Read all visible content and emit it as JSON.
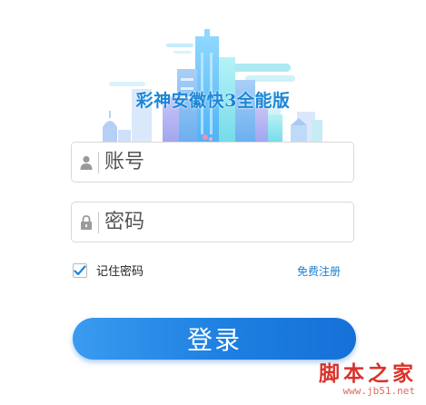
{
  "app": {
    "title": "彩神安徽快3全能版"
  },
  "login_form": {
    "account": {
      "placeholder": "账号",
      "value": "",
      "icon": "user-icon"
    },
    "password": {
      "placeholder": "密码",
      "value": "",
      "icon": "lock-icon"
    },
    "remember": {
      "label": "记住密码",
      "checked": true
    },
    "register_label": "免费注册",
    "login_label": "登录"
  },
  "watermark": {
    "main": "脚本之家",
    "url": "www.jb51.net"
  },
  "colors": {
    "accent": "#1a86d8",
    "button_start": "#3a9bf0",
    "button_end": "#1670d8",
    "link": "#1a7fd3",
    "watermark": "#d9322b"
  }
}
